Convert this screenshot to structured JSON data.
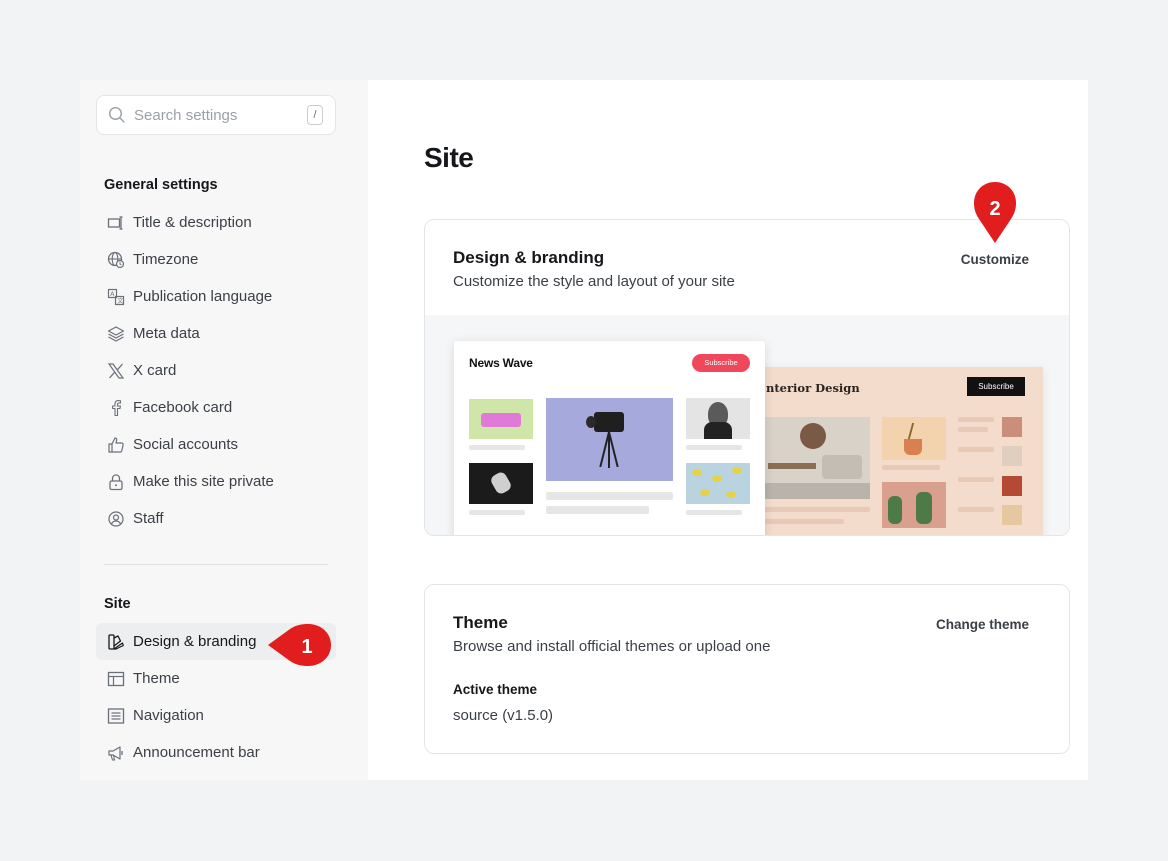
{
  "search": {
    "placeholder": "Search settings",
    "shortcut": "/"
  },
  "sidebar": {
    "general_title": "General settings",
    "general_items": [
      {
        "label": "Title & description",
        "icon": "title-icon"
      },
      {
        "label": "Timezone",
        "icon": "globe-clock-icon"
      },
      {
        "label": "Publication language",
        "icon": "translate-icon"
      },
      {
        "label": "Meta data",
        "icon": "layers-icon"
      },
      {
        "label": "X card",
        "icon": "x-logo-icon"
      },
      {
        "label": "Facebook card",
        "icon": "facebook-icon"
      },
      {
        "label": "Social accounts",
        "icon": "thumbs-up-icon"
      },
      {
        "label": "Make this site private",
        "icon": "lock-icon"
      },
      {
        "label": "Staff",
        "icon": "staff-icon"
      }
    ],
    "site_title": "Site",
    "site_items": [
      {
        "label": "Design & branding",
        "icon": "paint-icon",
        "active": true
      },
      {
        "label": "Theme",
        "icon": "layout-icon"
      },
      {
        "label": "Navigation",
        "icon": "list-icon"
      },
      {
        "label": "Announcement bar",
        "icon": "megaphone-icon"
      }
    ]
  },
  "main": {
    "title": "Site",
    "design_card": {
      "title": "Design & branding",
      "description": "Customize the style and layout of your site",
      "action": "Customize"
    },
    "preview": {
      "front_title": "News Wave",
      "front_button": "Subscribe",
      "back_title": "nterior Design",
      "back_button": "Subscribe"
    },
    "theme_card": {
      "title": "Theme",
      "description": "Browse and install official themes or upload one",
      "action": "Change theme",
      "active_label": "Active theme",
      "active_value": "source (v1.5.0)"
    }
  },
  "markers": {
    "one": "1",
    "two": "2"
  },
  "colors": {
    "marker": "#e11d1d",
    "subscribe_red": "#f0475a",
    "accent_text": "#15171a"
  }
}
